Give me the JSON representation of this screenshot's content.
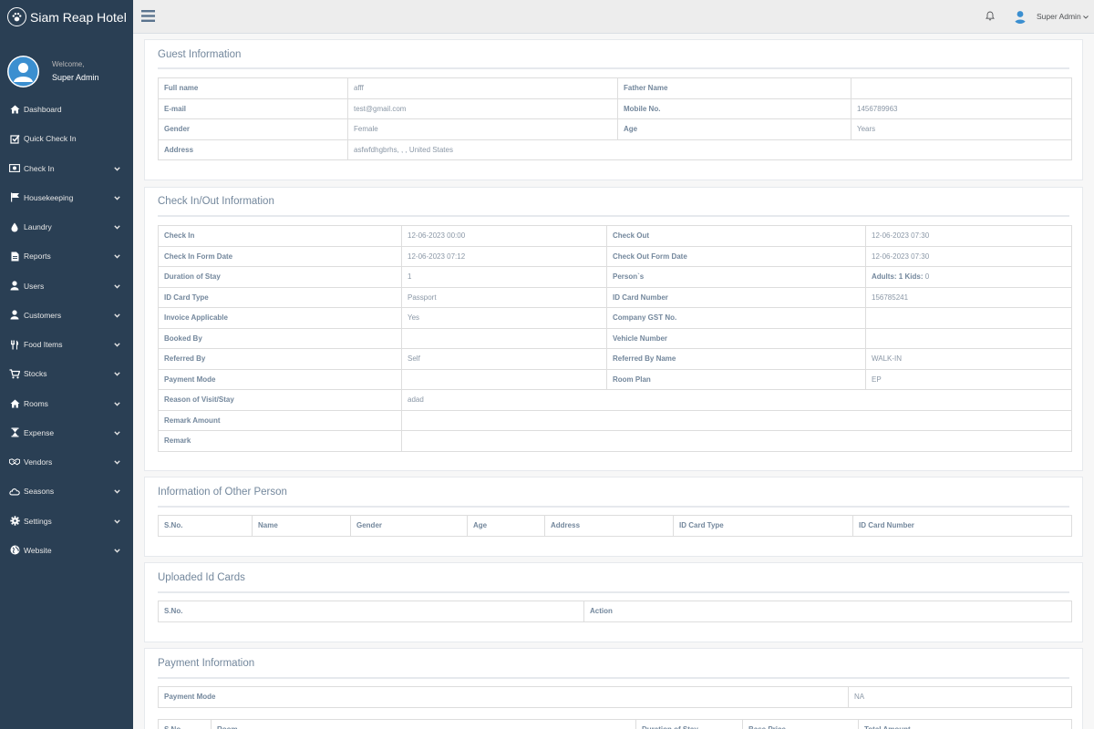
{
  "app": {
    "title": "Siam Reap Hotel"
  },
  "profile": {
    "welcome": "Welcome,",
    "name": "Super Admin"
  },
  "menu": [
    {
      "label": "Dashboard",
      "icon": "home-icon",
      "has_submenu": false
    },
    {
      "label": "Quick Check In",
      "icon": "checkbox-icon",
      "has_submenu": false
    },
    {
      "label": "Check In",
      "icon": "money-icon",
      "has_submenu": true
    },
    {
      "label": "Housekeeping",
      "icon": "flag-icon",
      "has_submenu": true
    },
    {
      "label": "Laundry",
      "icon": "drop-icon",
      "has_submenu": true
    },
    {
      "label": "Reports",
      "icon": "file-icon",
      "has_submenu": true
    },
    {
      "label": "Users",
      "icon": "user-icon",
      "has_submenu": true
    },
    {
      "label": "Customers",
      "icon": "user-icon",
      "has_submenu": true
    },
    {
      "label": "Food Items",
      "icon": "cutlery-icon",
      "has_submenu": true
    },
    {
      "label": "Stocks",
      "icon": "cart-icon",
      "has_submenu": true
    },
    {
      "label": "Rooms",
      "icon": "home-icon",
      "has_submenu": true
    },
    {
      "label": "Expense",
      "icon": "hourglass-icon",
      "has_submenu": true
    },
    {
      "label": "Vendors",
      "icon": "handshake-icon",
      "has_submenu": true
    },
    {
      "label": "Seasons",
      "icon": "cloud-icon",
      "has_submenu": true
    },
    {
      "label": "Settings",
      "icon": "gear-icon",
      "has_submenu": true
    },
    {
      "label": "Website",
      "icon": "globe-icon",
      "has_submenu": true
    }
  ],
  "topbar": {
    "user_name": "Super Admin"
  },
  "guest": {
    "title": "Guest Information",
    "rows": [
      [
        "Full name",
        "afff",
        "Father Name",
        ""
      ],
      [
        "E-mail",
        "test@gmail.com",
        "Mobile No.",
        "1456789963"
      ],
      [
        "Gender",
        "Female",
        "Age",
        "Years"
      ]
    ],
    "address_label": "Address",
    "address_value": "asfwfdhgbrhs, , , United States"
  },
  "checkin": {
    "title": "Check In/Out Information",
    "rows": [
      [
        "Check In",
        "12-06-2023 00:00",
        "Check Out",
        "12-06-2023 07:30"
      ],
      [
        "Check In Form Date",
        "12-06-2023 07:12",
        "Check Out Form Date",
        "12-06-2023 07:30"
      ],
      [
        "Duration of Stay",
        "1",
        "Person`s",
        ""
      ],
      [
        "ID Card Type",
        "Passport",
        "ID Card Number",
        "156785241"
      ],
      [
        "Invoice Applicable",
        "Yes",
        "Company GST No.",
        ""
      ],
      [
        "Booked By",
        "",
        "Vehicle Number",
        ""
      ],
      [
        "Referred By",
        "Self",
        "Referred By Name",
        "WALK-IN"
      ],
      [
        "Payment Mode",
        "",
        "Room Plan",
        "EP"
      ]
    ],
    "persons": {
      "adults_label": "Adults:",
      "adults": "1",
      "kids_label": "Kids:",
      "kids": "0"
    },
    "wide_rows": [
      [
        "Reason of Visit/Stay",
        "adad"
      ],
      [
        "Remark Amount",
        ""
      ],
      [
        "Remark",
        ""
      ]
    ]
  },
  "other_person": {
    "title": "Information of Other Person",
    "headers": [
      "S.No.",
      "Name",
      "Gender",
      "Age",
      "Address",
      "ID Card Type",
      "ID Card Number"
    ]
  },
  "uploaded": {
    "title": "Uploaded Id Cards",
    "headers": [
      "S.No.",
      "Action"
    ]
  },
  "payment": {
    "title": "Payment Information",
    "mode_label": "Payment Mode",
    "mode_value": "NA",
    "headers": [
      "S.No.",
      "Room",
      "Duration of Stay",
      "Base Price",
      "Total Amount"
    ]
  }
}
